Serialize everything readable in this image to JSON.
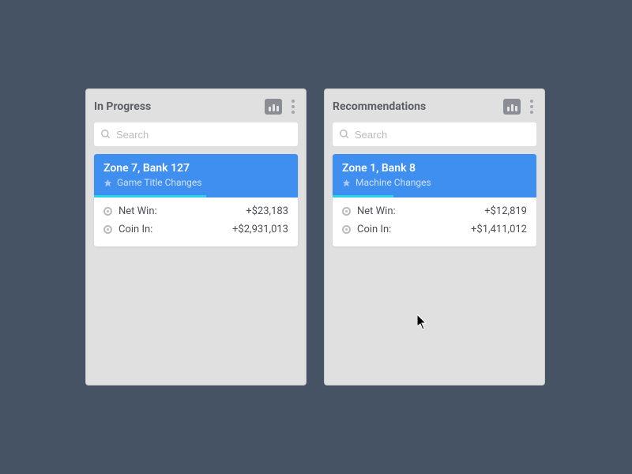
{
  "columns": [
    {
      "title": "In Progress",
      "search_placeholder": "Search",
      "card": {
        "title": "Zone 7, Bank 127",
        "subtitle": "Game Title Changes",
        "progress_pct": 55,
        "metrics": [
          {
            "label": "Net Win:",
            "value": "+$23,183"
          },
          {
            "label": "Coin In:",
            "value": "+$2,931,013"
          }
        ]
      }
    },
    {
      "title": "Recommendations",
      "search_placeholder": "Search",
      "card": {
        "title": "Zone 1, Bank 8",
        "subtitle": "Machine Changes",
        "progress_pct": 30,
        "metrics": [
          {
            "label": "Net Win:",
            "value": "+$12,819"
          },
          {
            "label": "Coin In:",
            "value": "+$1,411,012"
          }
        ]
      }
    }
  ]
}
